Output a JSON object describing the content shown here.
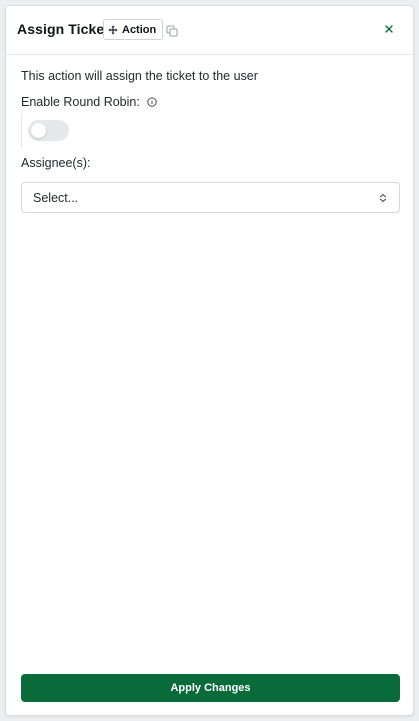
{
  "header": {
    "title": "Assign Ticket",
    "badge_label": "Action",
    "badge_icon": "action-move-icon",
    "copy_icon": "copy-icon",
    "close_icon": "close-icon"
  },
  "form": {
    "description": "This action will assign the ticket to the user",
    "round_robin_label": "Enable Round Robin:",
    "round_robin_enabled": false,
    "assignee_label": "Assignee(s):",
    "assignee_select_value": "Select..."
  },
  "footer": {
    "apply_label": "Apply Changes"
  },
  "colors": {
    "primary": "#0a6b3a",
    "close_icon": "#0a6b3a",
    "toggle_off": "#e5e7eb"
  }
}
